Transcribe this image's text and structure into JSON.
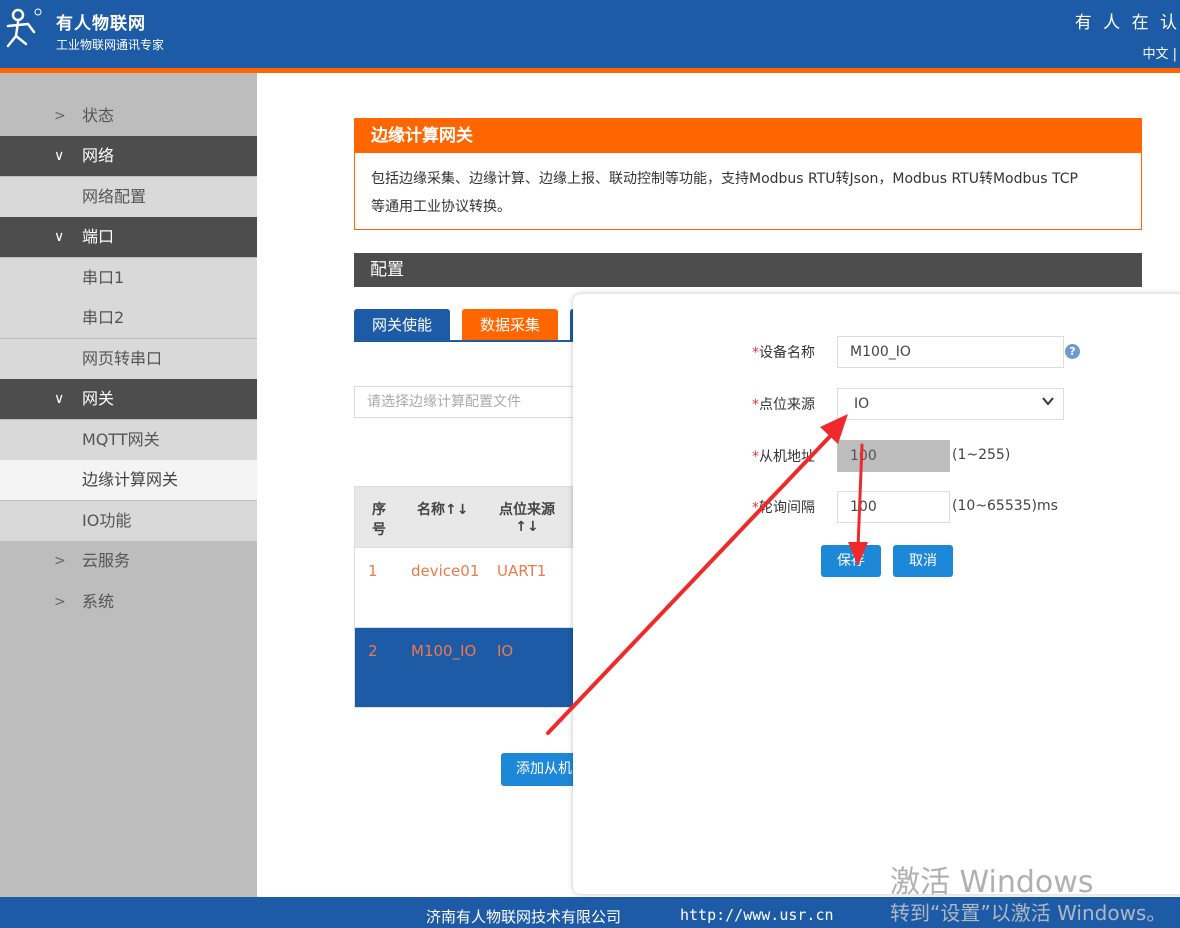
{
  "header": {
    "brand_name": "有人物联网",
    "slogan": "工业物联网通讯专家",
    "right_text": "有 人 在 认",
    "lang": "中文 |"
  },
  "sidebar": {
    "items": [
      {
        "label": "状态"
      },
      {
        "label": "网络"
      },
      {
        "label": "网络配置"
      },
      {
        "label": "端口"
      },
      {
        "label": "串口1"
      },
      {
        "label": "串口2"
      },
      {
        "label": "网页转串口"
      },
      {
        "label": "网关"
      },
      {
        "label": "MQTT网关"
      },
      {
        "label": "边缘计算网关"
      },
      {
        "label": "IO功能"
      },
      {
        "label": "云服务"
      },
      {
        "label": "系统"
      }
    ]
  },
  "intro": {
    "title": "边缘计算网关",
    "desc_line1": "包括边缘采集、边缘计算、边缘上报、联动控制等功能，支持Modbus RTU转Json，Modbus RTU转Modbus TCP",
    "desc_line2": "等通用工业协议转换。"
  },
  "config": {
    "title": "配置",
    "tabs": [
      "网关使能",
      "数据采集"
    ],
    "file_placeholder": "请选择边缘计算配置文件",
    "table": {
      "headers": {
        "seq_1": "序",
        "seq_2": "号",
        "name": "名称↑↓",
        "source_1": "点位来源",
        "source_2": "↑↓"
      },
      "rows": [
        {
          "seq": "1",
          "name": "device01",
          "source": "UART1"
        },
        {
          "seq": "2",
          "name": "M100_IO",
          "source": "IO"
        }
      ]
    },
    "add_button": "添加从机"
  },
  "modal": {
    "device_name_label": "设备名称",
    "device_name_value": "M100_IO",
    "source_label": "点位来源",
    "source_value": "IO",
    "slave_addr_label": "从机地址",
    "slave_addr_value": "100",
    "slave_addr_hint": "(1~255)",
    "poll_label": "轮询间隔",
    "poll_value": "100",
    "poll_hint": "(10~65535)ms",
    "required_mark": "*",
    "save": "保存",
    "cancel": "取消",
    "help": "?"
  },
  "footer": {
    "company": "济南有人物联网技术有限公司",
    "url": "http://www.usr.cn"
  },
  "watermark": {
    "line1": "激活 Windows",
    "line2": "转到“设置”以激活 Windows。"
  },
  "colors": {
    "brand_blue": "#1d5ba6",
    "accent_orange": "#ff6600",
    "button_blue": "#1e88d8",
    "arrow_red": "#f02a2a"
  }
}
